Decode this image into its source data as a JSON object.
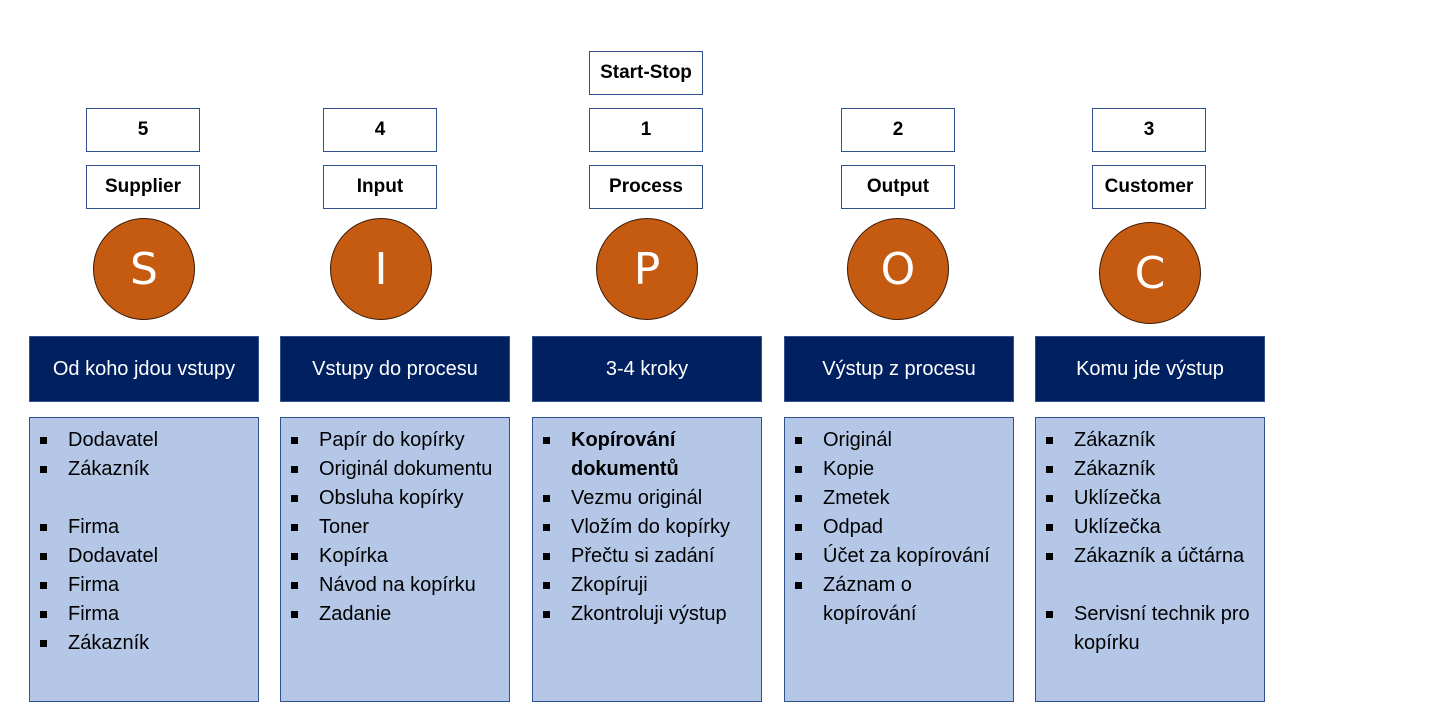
{
  "top_label": "Start-Stop",
  "colors": {
    "circle_fill": "#c55a11",
    "header_fill": "#002060",
    "content_fill": "#b4c7e7",
    "box_border": "#2f528f"
  },
  "columns": [
    {
      "order": "5",
      "name": "Supplier",
      "letter": "S",
      "header": "Od koho jdou vstupy",
      "items": [
        {
          "text": "Dodavatel"
        },
        {
          "text": "Zákazník"
        },
        {
          "text": "",
          "spacer": true
        },
        {
          "text": "Firma"
        },
        {
          "text": "Dodavatel"
        },
        {
          "text": "Firma"
        },
        {
          "text": "Firma"
        },
        {
          "text": "Zákazník"
        }
      ]
    },
    {
      "order": "4",
      "name": "Input",
      "letter": "I",
      "header": "Vstupy do procesu",
      "items": [
        {
          "text": "Papír do kopírky"
        },
        {
          "text": "Originál dokumentu"
        },
        {
          "text": "Obsluha kopírky"
        },
        {
          "text": "Toner"
        },
        {
          "text": "Kopírka"
        },
        {
          "text": "Návod na kopírku"
        },
        {
          "text": "Zadanie"
        }
      ]
    },
    {
      "order": "1",
      "name": "Process",
      "letter": "P",
      "header": "3-4 kroky",
      "items": [
        {
          "text": "Kopírování dokumentů",
          "bold": true
        },
        {
          "text": "Vezmu originál"
        },
        {
          "text": "Vložím do kopírky"
        },
        {
          "text": "Přečtu si zadání"
        },
        {
          "text": "Zkopíruji"
        },
        {
          "text": "Zkontroluji výstup"
        }
      ]
    },
    {
      "order": "2",
      "name": "Output",
      "letter": "O",
      "header": "Výstup z procesu",
      "items": [
        {
          "text": "Originál"
        },
        {
          "text": "Kopie"
        },
        {
          "text": "Zmetek"
        },
        {
          "text": "Odpad"
        },
        {
          "text": "Účet za kopírování"
        },
        {
          "text": "Záznam o kopírování"
        }
      ]
    },
    {
      "order": "3",
      "name": "Customer",
      "letter": "C",
      "header": "Komu jde výstup",
      "items": [
        {
          "text": "Zákazník"
        },
        {
          "text": "Zákazník"
        },
        {
          "text": "Uklízečka"
        },
        {
          "text": "Uklízečka"
        },
        {
          "text": "Zákazník a účtárna"
        },
        {
          "text": "",
          "spacer": true
        },
        {
          "text": "Servisní technik pro kopírku"
        }
      ]
    }
  ]
}
